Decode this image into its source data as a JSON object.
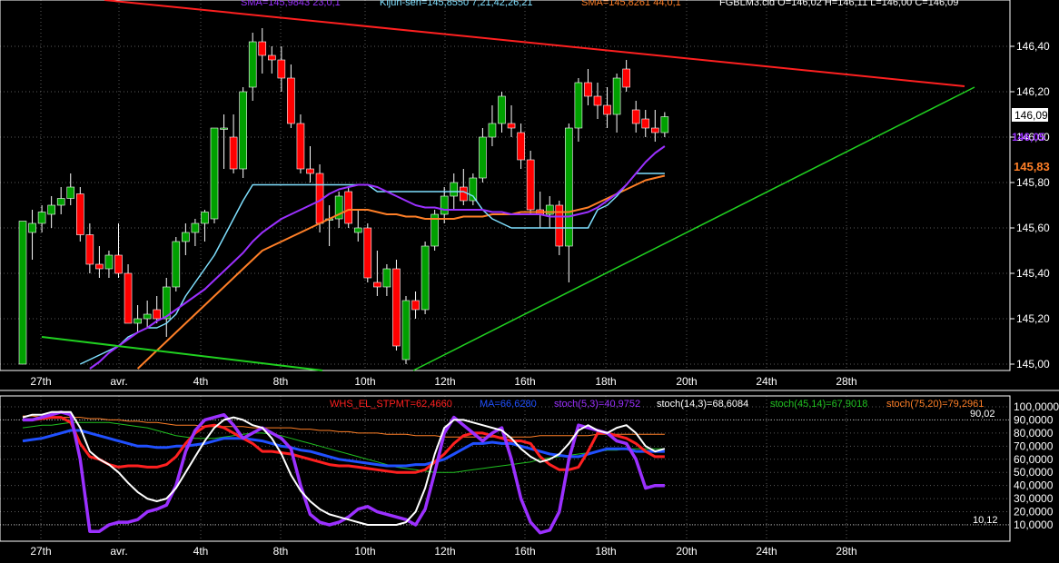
{
  "price_panel": {
    "header_items": [
      {
        "text": "SMA=145,9843  23,0,1",
        "color": "#9b30ff"
      },
      {
        "text": "Kijun-sen=145,8550  7,21,42,26,21",
        "color": "#7fe0ff"
      },
      {
        "text": "SMA=145,8261  44,0,1",
        "color": "#ff7f27"
      },
      {
        "text": "FGBLM3.cld O=146,02 H=146,11 L=146,00 C=146,09",
        "color": "#ffffff"
      }
    ],
    "y_ticks": [
      "146,40",
      "146,20",
      "146,00",
      "145,80",
      "145,60",
      "145,40",
      "145,20",
      "145,00"
    ],
    "last_price_label": "146,09",
    "sma23_label": "146,05",
    "sma44_label": "145,83"
  },
  "indicator_panel": {
    "header_items": [
      {
        "text": "WHS_EL_STPMT=62,4660",
        "color": "#ff2020"
      },
      {
        "text": "MA=66,6280",
        "color": "#2050ff"
      },
      {
        "text": "stoch(5,3)=40,9752",
        "color": "#9b30ff"
      },
      {
        "text": "stoch(14,3)=68,6084",
        "color": "#ffffff"
      },
      {
        "text": "stoch(45,14)=67,9018",
        "color": "#20c020"
      },
      {
        "text": "stoch(75,20)=79,2961",
        "color": "#ff7f27"
      }
    ],
    "y_ticks": [
      "100,0000",
      "90,0000",
      "80,0000",
      "70,0000",
      "60,0000",
      "50,0000",
      "40,0000",
      "30,0000",
      "20,0000",
      "10,0000"
    ],
    "upper_level": "90,02",
    "lower_level": "10,12"
  },
  "x_ticks": [
    "27th",
    "avr.",
    "4th",
    "8th",
    "10th",
    "12th",
    "16th",
    "18th",
    "20th",
    "24th",
    "28th"
  ],
  "colors": {
    "up": "#00a000",
    "down": "#ff0000",
    "grid": "#5a5a5a",
    "resistance": "#ff2020",
    "support": "#20d020"
  },
  "chart_data": [
    {
      "type": "candlestick",
      "title": "FGBLM3",
      "ylim": [
        144.98,
        146.52
      ],
      "candles": [
        [
          145.0,
          145.63,
          145.0,
          145.63
        ],
        [
          145.58,
          145.68,
          145.46,
          145.62
        ],
        [
          145.62,
          145.7,
          145.58,
          145.67
        ],
        [
          145.66,
          145.74,
          145.6,
          145.7
        ],
        [
          145.7,
          145.78,
          145.66,
          145.73
        ],
        [
          145.73,
          145.84,
          145.7,
          145.78
        ],
        [
          145.75,
          145.78,
          145.54,
          145.57
        ],
        [
          145.57,
          145.62,
          145.4,
          145.44
        ],
        [
          145.44,
          145.52,
          145.38,
          145.42
        ],
        [
          145.42,
          145.5,
          145.38,
          145.48
        ],
        [
          145.48,
          145.62,
          145.38,
          145.4
        ],
        [
          145.4,
          145.44,
          145.18,
          145.18
        ],
        [
          145.18,
          145.26,
          145.14,
          145.2
        ],
        [
          145.2,
          145.28,
          145.16,
          145.22
        ],
        [
          145.24,
          145.3,
          145.18,
          145.2
        ],
        [
          145.2,
          145.38,
          145.12,
          145.34
        ],
        [
          145.34,
          145.56,
          145.32,
          145.54
        ],
        [
          145.54,
          145.62,
          145.48,
          145.58
        ],
        [
          145.58,
          145.64,
          145.52,
          145.62
        ],
        [
          145.62,
          145.68,
          145.54,
          145.67
        ],
        [
          145.64,
          146.04,
          145.62,
          146.04
        ],
        [
          146.04,
          146.1,
          145.86,
          146.04
        ],
        [
          146.0,
          146.1,
          145.84,
          145.86
        ],
        [
          145.86,
          146.22,
          145.82,
          146.2
        ],
        [
          146.22,
          146.46,
          146.16,
          146.42
        ],
        [
          146.42,
          146.48,
          146.28,
          146.36
        ],
        [
          146.36,
          146.4,
          146.28,
          146.34
        ],
        [
          146.34,
          146.4,
          146.2,
          146.26
        ],
        [
          146.26,
          146.32,
          146.04,
          146.06
        ],
        [
          146.06,
          146.1,
          145.84,
          145.86
        ],
        [
          145.86,
          145.96,
          145.8,
          145.84
        ],
        [
          145.84,
          145.88,
          145.58,
          145.62
        ],
        [
          145.64,
          145.7,
          145.52,
          145.64
        ],
        [
          145.64,
          145.76,
          145.6,
          145.74
        ],
        [
          145.76,
          145.78,
          145.6,
          145.62
        ],
        [
          145.58,
          145.68,
          145.54,
          145.6
        ],
        [
          145.6,
          145.62,
          145.36,
          145.38
        ],
        [
          145.36,
          145.5,
          145.3,
          145.34
        ],
        [
          145.34,
          145.44,
          145.3,
          145.42
        ],
        [
          145.42,
          145.46,
          145.06,
          145.08
        ],
        [
          145.02,
          145.3,
          145.0,
          145.28
        ],
        [
          145.28,
          145.32,
          145.2,
          145.24
        ],
        [
          145.24,
          145.54,
          145.22,
          145.52
        ],
        [
          145.52,
          145.68,
          145.5,
          145.66
        ],
        [
          145.66,
          145.78,
          145.62,
          145.74
        ],
        [
          145.74,
          145.84,
          145.68,
          145.8
        ],
        [
          145.78,
          145.86,
          145.7,
          145.72
        ],
        [
          145.72,
          145.84,
          145.7,
          145.82
        ],
        [
          145.82,
          146.04,
          145.8,
          146.0
        ],
        [
          146.0,
          146.14,
          145.96,
          146.06
        ],
        [
          146.06,
          146.2,
          146.02,
          146.18
        ],
        [
          146.06,
          146.14,
          146.0,
          146.04
        ],
        [
          146.02,
          146.06,
          145.86,
          145.9
        ],
        [
          145.9,
          145.94,
          145.66,
          145.68
        ],
        [
          145.68,
          145.76,
          145.6,
          145.66
        ],
        [
          145.66,
          145.74,
          145.6,
          145.7
        ],
        [
          145.7,
          145.72,
          145.48,
          145.52
        ],
        [
          145.52,
          146.06,
          145.36,
          146.04
        ],
        [
          146.04,
          146.26,
          145.98,
          146.24
        ],
        [
          146.24,
          146.3,
          146.14,
          146.18
        ],
        [
          146.18,
          146.24,
          146.08,
          146.14
        ],
        [
          146.14,
          146.22,
          146.04,
          146.1
        ],
        [
          146.1,
          146.28,
          146.02,
          146.26
        ],
        [
          146.3,
          146.34,
          146.2,
          146.22
        ],
        [
          146.12,
          146.16,
          146.02,
          146.06
        ],
        [
          146.08,
          146.12,
          146.0,
          146.04
        ],
        [
          146.04,
          146.12,
          145.98,
          146.02
        ],
        [
          146.02,
          146.11,
          146.0,
          146.09
        ]
      ],
      "sma23": [
        144.7,
        144.74,
        144.78,
        144.82,
        144.86,
        144.9,
        144.94,
        144.98,
        145.01,
        145.05,
        145.08,
        145.11,
        145.14,
        145.16,
        145.19,
        145.21,
        145.24,
        145.27,
        145.3,
        145.33,
        145.37,
        145.41,
        145.45,
        145.49,
        145.54,
        145.58,
        145.61,
        145.64,
        145.66,
        145.68,
        145.7,
        145.72,
        145.75,
        145.77,
        145.78,
        145.79,
        145.79,
        145.78,
        145.76,
        145.74,
        145.72,
        145.7,
        145.69,
        145.69,
        145.68,
        145.68,
        145.68,
        145.68,
        145.68,
        145.67,
        145.67,
        145.66,
        145.66,
        145.66,
        145.66,
        145.65,
        145.65,
        145.65,
        145.66,
        145.67,
        145.69,
        145.72,
        145.75,
        145.79,
        145.84,
        145.89,
        145.93,
        145.96
      ],
      "kijun": [
        144.6,
        144.7,
        144.8,
        144.88,
        144.92,
        144.96,
        145.0,
        145.02,
        145.04,
        145.06,
        145.08,
        145.12,
        145.14,
        145.16,
        145.16,
        145.18,
        145.22,
        145.3,
        145.36,
        145.42,
        145.48,
        145.56,
        145.64,
        145.72,
        145.79,
        145.79,
        145.79,
        145.79,
        145.79,
        145.79,
        145.79,
        145.79,
        145.79,
        145.79,
        145.79,
        145.79,
        145.79,
        145.76,
        145.76,
        145.76,
        145.76,
        145.76,
        145.76,
        145.76,
        145.76,
        145.76,
        145.76,
        145.74,
        145.68,
        145.64,
        145.62,
        145.6,
        145.6,
        145.6,
        145.6,
        145.6,
        145.6,
        145.6,
        145.6,
        145.6,
        145.68,
        145.7,
        145.74,
        145.79,
        145.84,
        145.84,
        145.84,
        145.84
      ],
      "sma44": [
        144.5,
        144.54,
        144.58,
        144.62,
        144.66,
        144.7,
        144.74,
        144.78,
        144.82,
        144.86,
        144.9,
        144.94,
        144.98,
        145.02,
        145.06,
        145.1,
        145.14,
        145.18,
        145.22,
        145.26,
        145.3,
        145.34,
        145.38,
        145.42,
        145.46,
        145.5,
        145.52,
        145.54,
        145.56,
        145.58,
        145.6,
        145.62,
        145.64,
        145.66,
        145.68,
        145.68,
        145.68,
        145.67,
        145.66,
        145.66,
        145.65,
        145.65,
        145.64,
        145.64,
        145.64,
        145.64,
        145.65,
        145.65,
        145.65,
        145.66,
        145.66,
        145.66,
        145.67,
        145.67,
        145.67,
        145.67,
        145.67,
        145.67,
        145.68,
        145.69,
        145.71,
        145.73,
        145.75,
        145.77,
        145.79,
        145.81,
        145.82,
        145.83
      ]
    },
    {
      "type": "line",
      "title": "",
      "ylim": [
        0,
        100
      ],
      "series": [
        {
          "name": "WHS_EL_STPMT",
          "values": [
            90,
            90,
            91,
            92,
            92,
            88,
            72,
            62,
            60,
            56,
            54,
            55,
            55,
            54,
            54,
            56,
            62,
            72,
            80,
            85,
            86,
            84,
            80,
            76,
            72,
            66,
            66,
            65,
            64,
            62,
            60,
            58,
            56,
            55,
            55,
            54,
            53,
            52,
            51,
            50,
            50,
            50,
            52,
            58,
            64,
            72,
            78,
            80,
            80,
            78,
            76,
            74,
            74,
            72,
            62,
            56,
            52,
            52,
            54,
            66,
            80,
            80,
            78,
            76,
            72,
            66,
            62,
            62
          ]
        },
        {
          "name": "MA",
          "values": [
            74,
            75,
            76,
            78,
            80,
            82,
            82,
            80,
            78,
            76,
            74,
            72,
            70,
            70,
            69,
            69,
            70,
            70,
            71,
            72,
            74,
            76,
            76,
            76,
            75,
            74,
            72,
            70,
            69,
            67,
            66,
            64,
            62,
            60,
            59,
            58,
            57,
            56,
            55,
            55,
            55,
            56,
            56,
            58,
            60,
            64,
            68,
            72,
            72,
            73,
            72,
            72,
            70,
            68,
            66,
            64,
            63,
            62,
            62,
            64,
            66,
            68,
            68,
            68,
            66,
            66,
            66,
            66
          ]
        },
        {
          "name": "stoch(5,3)",
          "values": [
            90,
            90,
            92,
            94,
            96,
            94,
            60,
            5,
            5,
            10,
            12,
            12,
            14,
            20,
            22,
            25,
            40,
            66,
            82,
            90,
            92,
            94,
            86,
            76,
            80,
            84,
            80,
            76,
            68,
            40,
            18,
            12,
            10,
            12,
            16,
            22,
            24,
            20,
            18,
            16,
            14,
            10,
            22,
            50,
            80,
            92,
            86,
            80,
            74,
            80,
            84,
            60,
            30,
            12,
            4,
            6,
            20,
            60,
            86,
            84,
            82,
            80,
            74,
            72,
            60,
            38,
            40,
            40
          ]
        },
        {
          "name": "stoch(14,3)",
          "values": [
            92,
            94,
            94,
            96,
            96,
            96,
            84,
            66,
            60,
            56,
            50,
            42,
            35,
            30,
            28,
            30,
            38,
            50,
            62,
            74,
            84,
            90,
            92,
            90,
            86,
            84,
            76,
            64,
            48,
            36,
            28,
            22,
            18,
            16,
            14,
            12,
            10,
            10,
            10,
            10,
            12,
            20,
            38,
            64,
            84,
            90,
            90,
            88,
            86,
            84,
            82,
            76,
            68,
            62,
            58,
            60,
            64,
            72,
            82,
            86,
            82,
            80,
            84,
            86,
            80,
            70,
            66,
            68
          ]
        },
        {
          "name": "stoch(45,14)",
          "values": [
            84,
            85,
            86,
            86,
            87,
            88,
            88,
            88,
            88,
            88,
            87,
            86,
            85,
            84,
            82,
            80,
            78,
            77,
            76,
            76,
            76,
            77,
            78,
            79,
            80,
            80,
            79,
            78,
            76,
            74,
            72,
            70,
            68,
            66,
            64,
            62,
            60,
            58,
            56,
            54,
            53,
            52,
            51,
            50,
            50,
            50,
            51,
            52,
            53,
            54,
            55,
            56,
            57,
            58,
            60,
            61,
            62,
            63,
            64,
            65,
            66,
            67,
            67,
            68,
            68,
            68,
            68,
            68
          ]
        },
        {
          "name": "stoch(75,20)",
          "values": [
            93,
            93,
            92,
            92,
            92,
            92,
            92,
            91,
            91,
            90,
            90,
            89,
            89,
            88,
            88,
            87,
            86,
            86,
            86,
            85,
            85,
            85,
            85,
            85,
            84,
            84,
            84,
            84,
            84,
            83,
            83,
            82,
            82,
            81,
            81,
            80,
            80,
            80,
            79,
            79,
            79,
            78,
            78,
            78,
            77,
            77,
            77,
            77,
            77,
            77,
            77,
            77,
            77,
            77,
            78,
            78,
            78,
            78,
            78,
            78,
            79,
            79,
            79,
            79,
            79,
            79,
            79,
            79
          ]
        }
      ]
    }
  ]
}
